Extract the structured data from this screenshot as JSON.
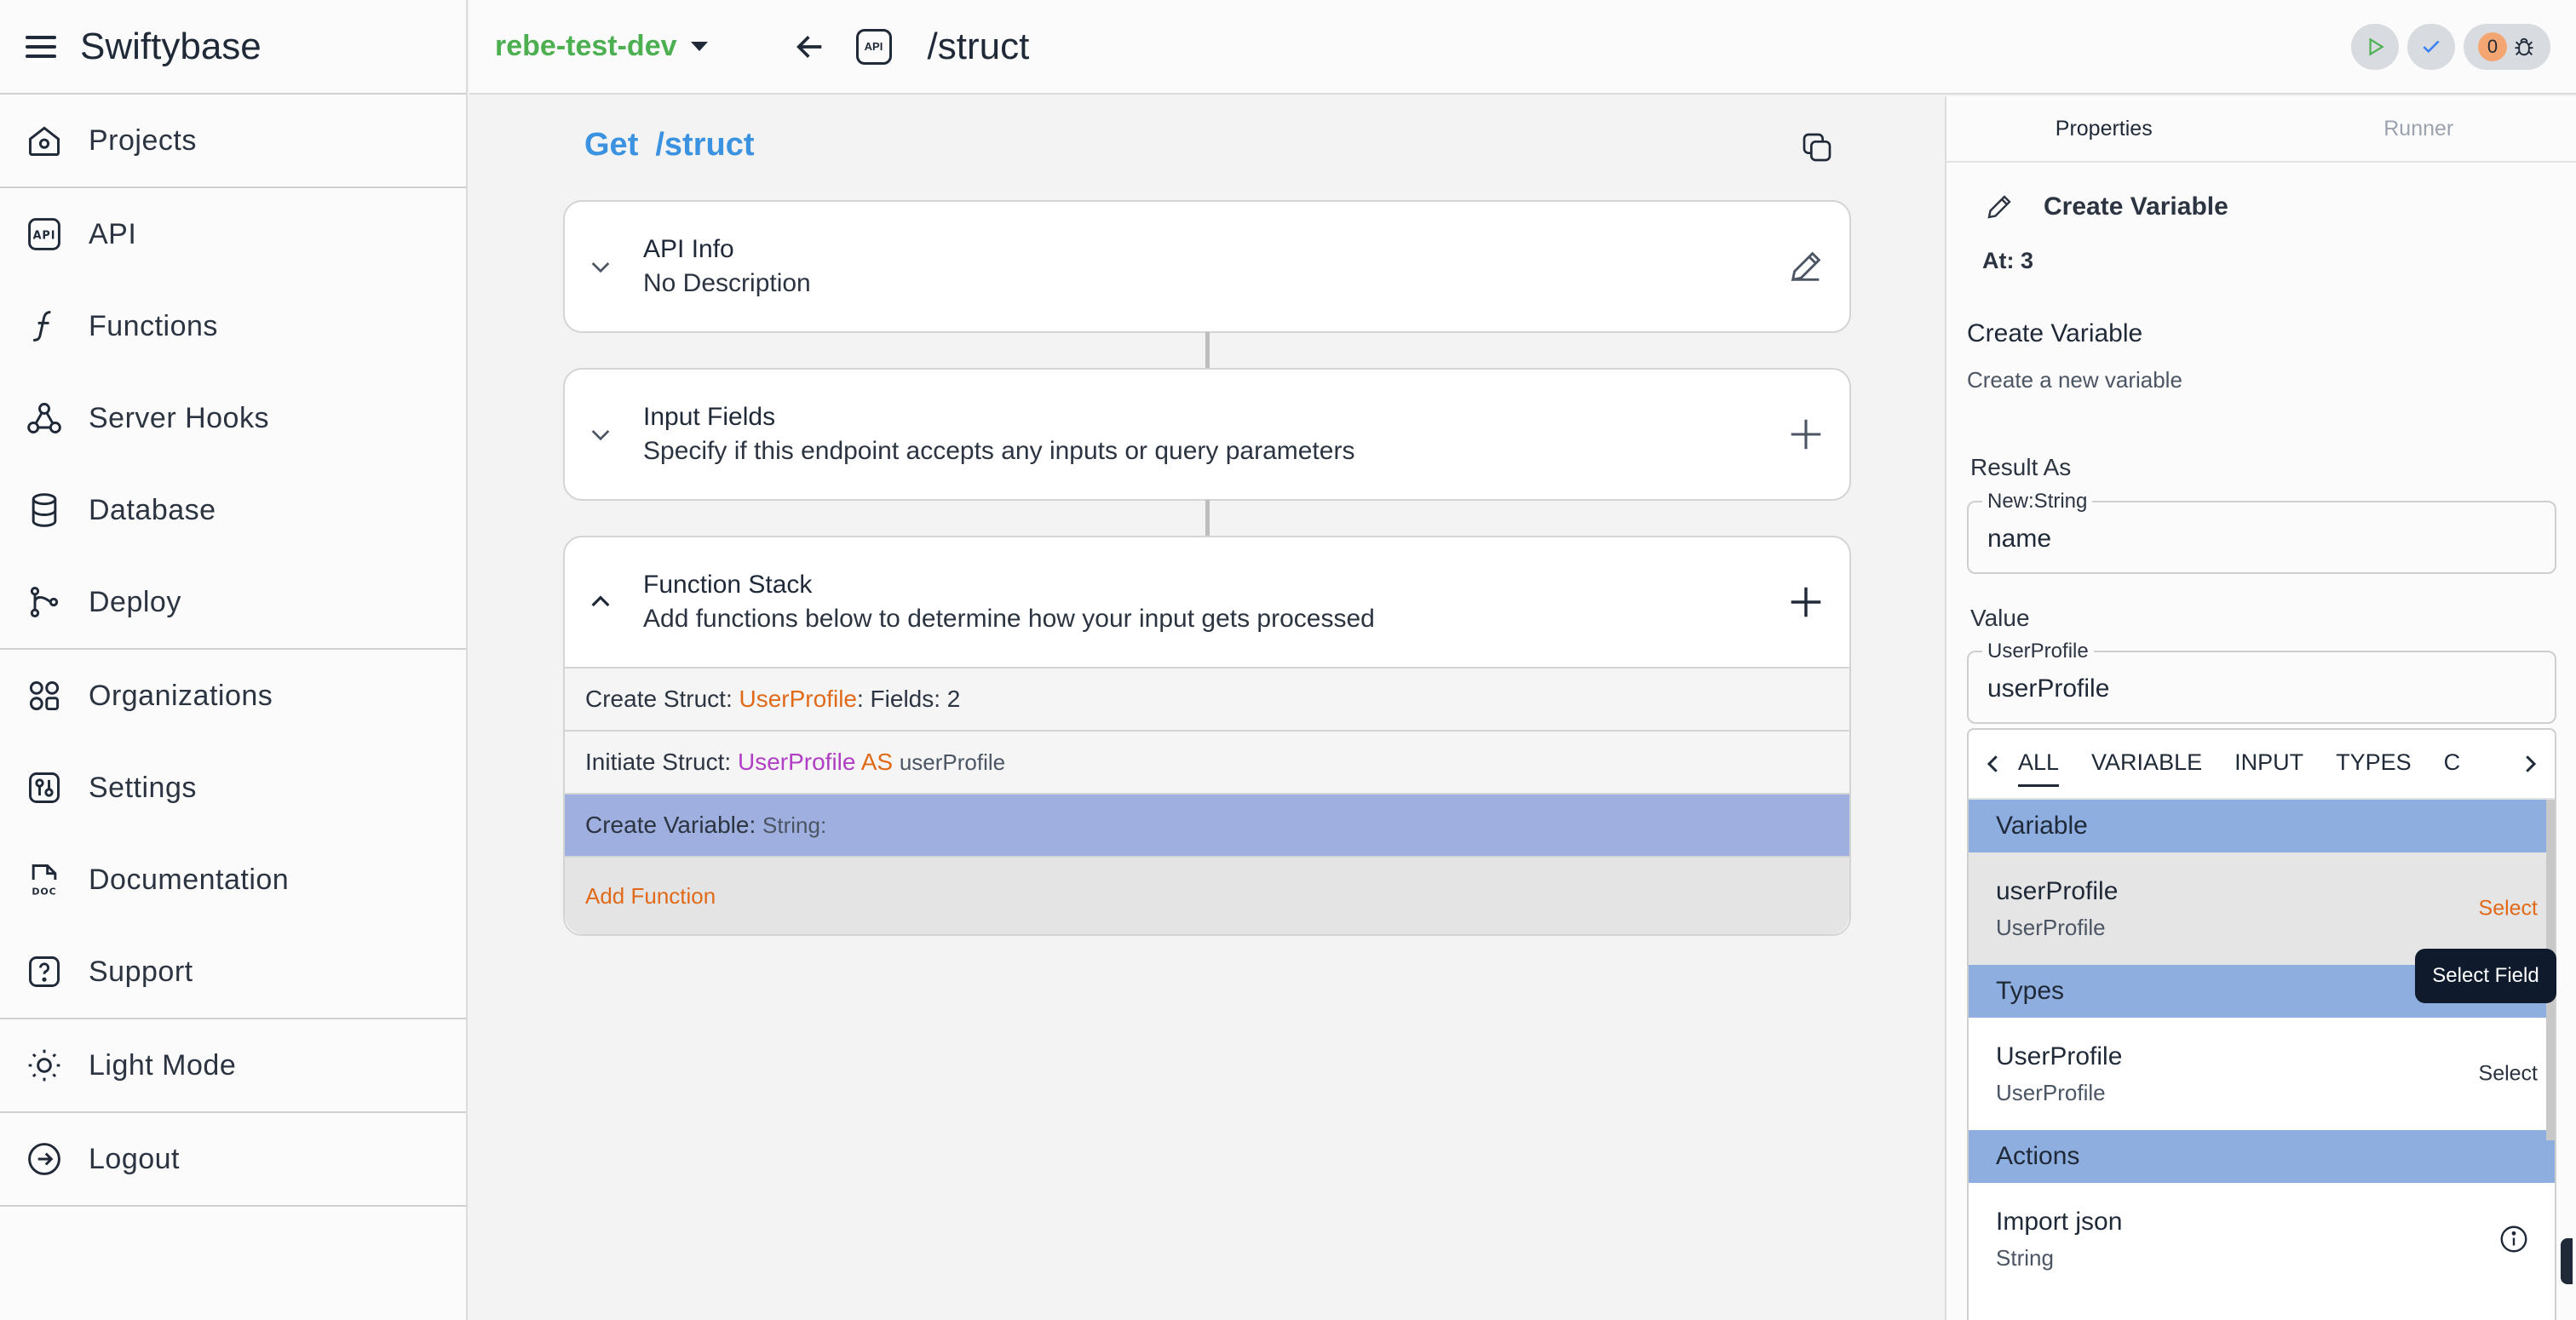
{
  "app": {
    "title": "Swiftybase"
  },
  "sidebar": {
    "groups": [
      [
        {
          "label": "Projects",
          "icon": "home-icon"
        }
      ],
      [
        {
          "label": "API",
          "icon": "api-icon"
        },
        {
          "label": "Functions",
          "icon": "function-icon"
        },
        {
          "label": "Server Hooks",
          "icon": "webhook-icon"
        },
        {
          "label": "Database",
          "icon": "database-icon"
        },
        {
          "label": "Deploy",
          "icon": "git-branch-icon"
        }
      ],
      [
        {
          "label": "Organizations",
          "icon": "organization-icon"
        },
        {
          "label": "Settings",
          "icon": "settings-icon"
        },
        {
          "label": "Documentation",
          "icon": "doc-icon"
        },
        {
          "label": "Support",
          "icon": "help-icon"
        }
      ],
      [
        {
          "label": "Light Mode",
          "icon": "sun-icon"
        }
      ],
      [
        {
          "label": "Logout",
          "icon": "logout-icon"
        }
      ]
    ]
  },
  "topbar": {
    "project": "rebe-test-dev",
    "api_badge": "API",
    "route": "/struct",
    "error_count": "0"
  },
  "main": {
    "method": "Get",
    "path": "/struct",
    "api_info": {
      "title": "API Info",
      "subtitle": "No Description"
    },
    "input_fields": {
      "title": "Input Fields",
      "subtitle": "Specify if this endpoint accepts any inputs or query parameters"
    },
    "function_stack": {
      "title": "Function Stack",
      "subtitle": "Add functions below to determine how your input gets processed",
      "rows": [
        {
          "prefix": "Create Struct: ",
          "name": "UserProfile",
          "suffix": ": Fields: 2"
        },
        {
          "prefix": "Initiate Struct: ",
          "name": "UserProfile",
          "as": " AS ",
          "var": "userProfile"
        },
        {
          "prefix": "Create Variable: ",
          "type": "String:"
        }
      ],
      "add_label": "Add Function"
    }
  },
  "panel": {
    "tabs": [
      "Properties",
      "Runner"
    ],
    "header": "Create Variable",
    "at": "At: 3",
    "title": "Create Variable",
    "description": "Create a new variable",
    "result_label": "Result As",
    "result_legend": "New:String",
    "result_value": "name",
    "value_label": "Value",
    "value_legend": "UserProfile",
    "value_value": "userProfile",
    "picker": {
      "tabs": [
        "ALL",
        "VARIABLE",
        "INPUT",
        "TYPES",
        "C"
      ],
      "sections": {
        "variable": "Variable",
        "types": "Types",
        "actions": "Actions"
      },
      "variable_item": {
        "name": "userProfile",
        "type": "UserProfile",
        "action": "Select"
      },
      "types_item": {
        "name": "UserProfile",
        "type": "UserProfile",
        "action": "Select"
      },
      "actions_item": {
        "name": "Import json",
        "type": "String"
      }
    },
    "tooltip": "Select Field"
  }
}
